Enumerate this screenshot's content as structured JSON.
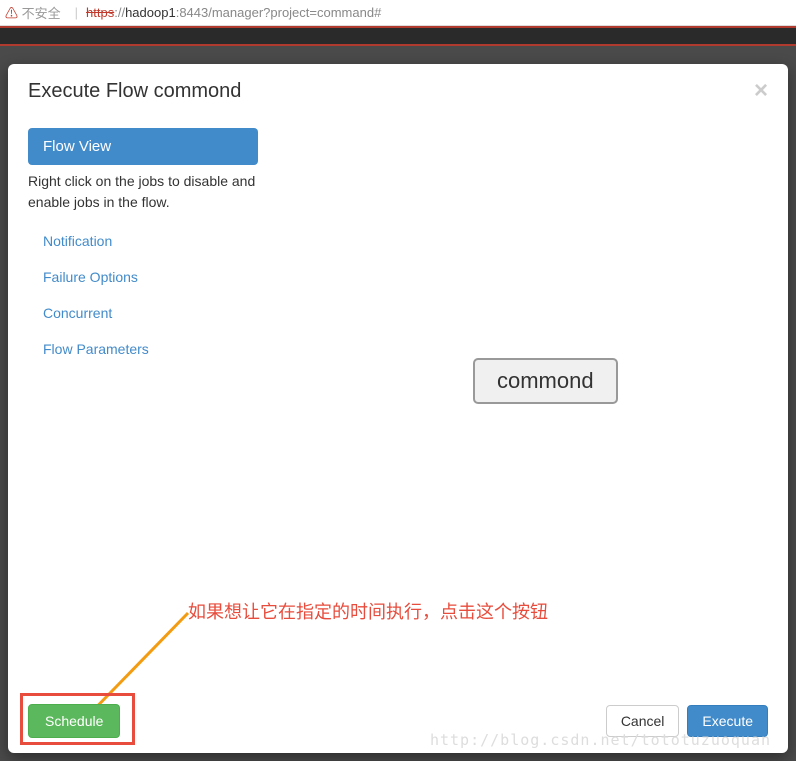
{
  "addressBar": {
    "securityLabel": "不安全",
    "protocol": "https",
    "separator": "://",
    "host": "hadoop1",
    "rest": ":8443/manager?project=command#"
  },
  "modal": {
    "title": "Execute Flow commond",
    "closeSymbol": "×"
  },
  "sidebar": {
    "flowViewLabel": "Flow View",
    "hint": "Right click on the jobs to disable and enable jobs in the flow.",
    "items": [
      {
        "label": "Notification"
      },
      {
        "label": "Failure Options"
      },
      {
        "label": "Concurrent"
      },
      {
        "label": "Flow Parameters"
      }
    ]
  },
  "content": {
    "nodeLabel": "commond"
  },
  "annotation": {
    "text": "如果想让它在指定的时间执行，点击这个按钮"
  },
  "footer": {
    "scheduleLabel": "Schedule",
    "cancelLabel": "Cancel",
    "executeLabel": "Execute"
  },
  "watermark": "http://blog.csdn.net/tototuzuoquan"
}
